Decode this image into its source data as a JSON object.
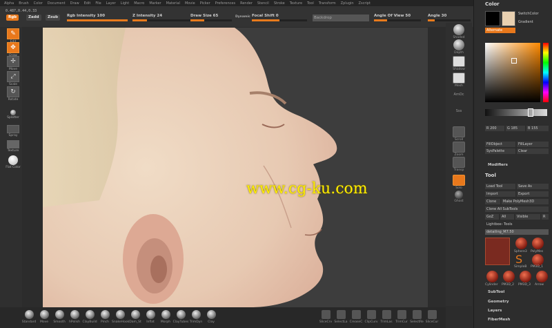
{
  "menubar": [
    "Alpha",
    "Brush",
    "Color",
    "Document",
    "Draw",
    "Edit",
    "File",
    "Layer",
    "Light",
    "Macro",
    "Marker",
    "Material",
    "Movie",
    "Picker",
    "Preferences",
    "Render",
    "Stencil",
    "Stroke",
    "Texture",
    "Tool",
    "Transform",
    "Zplugin",
    "Zscript"
  ],
  "topshelf": {
    "coords": "0.487,0.44,0.33",
    "rgb_label": "Rgb",
    "mrgb_label": "Zadd",
    "zsub_label": "Zsub",
    "rgb_intensity": {
      "label": "Rgb Intensity 100",
      "value": 100
    },
    "z_intensity": {
      "label": "Z Intensity 24",
      "value": 24
    },
    "draw_size": {
      "label": "Draw Size 65",
      "value": 65
    },
    "dynamic_label": "Dynamic",
    "focal_shift": {
      "label": "Focal Shift 0",
      "value": 0
    },
    "field_label": "Backdrop",
    "angle_of_view": {
      "label": "Angle Of View 50",
      "value": 50
    },
    "angle": {
      "label": "Angle 30",
      "value": 30
    }
  },
  "leftbar": {
    "edit": "Edit",
    "draw": "Draw",
    "move": "Move",
    "scale": "Scale",
    "rotate": "Rotate",
    "splatter": "Splatter",
    "spray": "Spray",
    "texture": "Texture",
    "flat_color": "Flat Color"
  },
  "canvas": {
    "watermark": "www.cg-ku.com"
  },
  "rightshelf": {
    "shaded": "Shaded",
    "depth": "Depth",
    "shadow": "Shadow",
    "mesh": "Mesh",
    "amoc": "AmOc",
    "sss": "Sss",
    "scroll": "Scroll",
    "zoom": "Zoom",
    "transp": "Transp",
    "solo": "Solo",
    "ghost": "Ghost"
  },
  "panel": {
    "color_title": "Color",
    "switch_color": "SwitchColor",
    "gradient": "Gradient",
    "alternate": "Alternate",
    "r_value": "R 200",
    "g_value": "G 185",
    "b_value": "B 155",
    "fill_object": "FillObject",
    "fill_layer": "FillLayer",
    "sys_palette": "SysPalette",
    "clear": "Clear",
    "modifiers": "Modifiers",
    "tool_title": "Tool",
    "load_tool": "Load Tool",
    "save_as": "Save As",
    "import": "Import",
    "export": "Export",
    "clone": "Clone",
    "make_polymesh": "Make PolyMesh3D",
    "clone_all": "Clone All SubTools",
    "goz": "GoZ",
    "all": "All",
    "visible": "Visible",
    "r": "R",
    "lightbox_tools": "Lightbox› Tools",
    "tool_slider": "detailing_M7.50",
    "thumbs": [
      "Sphere3",
      "PolyMes",
      "SimpleB",
      "PM3D_1",
      "Cylinder",
      "PM3D_2",
      "PM3D_3",
      "Arrow"
    ],
    "sections": [
      "SubTool",
      "Geometry",
      "Layers",
      "FiberMesh"
    ],
    "colors": {
      "accent": "#e8781c",
      "primary": "#e8d0b0",
      "secondary": "#ffffff"
    }
  },
  "bottombar": [
    "Standard",
    "Move",
    "Smooth",
    "hPolish",
    "ClayBuild",
    "Pinch",
    "SnakeHook",
    "Dam_St",
    "Inflat",
    "Morph",
    "ClayTubes",
    "TrimDyn",
    "Clay"
  ],
  "bottombar_right": [
    "SliceCrv",
    "SelectLa",
    "CreaseC",
    "ClipCurv",
    "TrimLas",
    "TrimCur",
    "SelectRe",
    "SliceCur"
  ]
}
